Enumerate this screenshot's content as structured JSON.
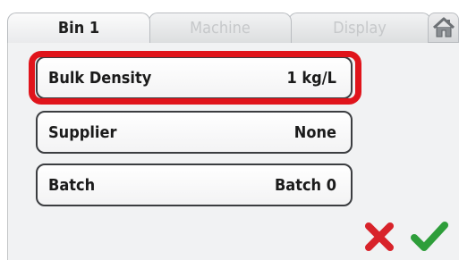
{
  "tabs": [
    {
      "label": "Bin 1",
      "active": true
    },
    {
      "label": "Machine",
      "active": false
    },
    {
      "label": "Display",
      "active": false
    }
  ],
  "fields": [
    {
      "label": "Bulk Density",
      "value": "1 kg/L",
      "highlighted": true
    },
    {
      "label": "Supplier",
      "value": "None"
    },
    {
      "label": "Batch",
      "value": "Batch 0"
    }
  ],
  "icons": {
    "home": "home-icon",
    "cancel": "x-icon",
    "confirm": "checkmark-icon"
  },
  "colors": {
    "highlight": "#e0141b",
    "cancel": "#d8232a",
    "confirm": "#2e9e3a"
  }
}
